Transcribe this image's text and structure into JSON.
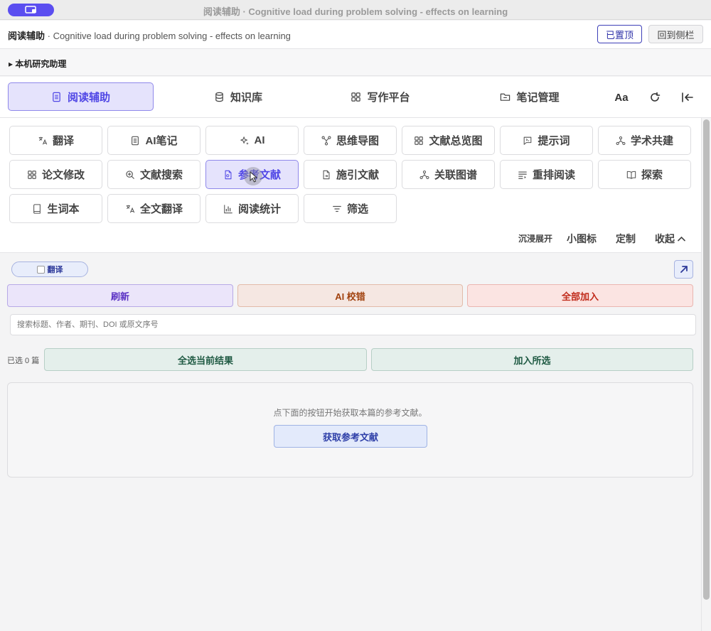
{
  "window": {
    "title": "阅读辅助 · Cognitive load during problem solving - effects on learning"
  },
  "header": {
    "app_name": "阅读辅助",
    "doc_title": " · Cognitive load during problem solving - effects on learning",
    "pinned_label": "已置顶",
    "back_label": "回到侧栏"
  },
  "assistant": {
    "label": "▸ 本机研究助理"
  },
  "main_nav": {
    "tabs": [
      {
        "label": "阅读辅助",
        "icon": "document-icon",
        "active": true
      },
      {
        "label": "知识库",
        "icon": "database-icon"
      },
      {
        "label": "写作平台",
        "icon": "grid-icon"
      },
      {
        "label": "笔记管理",
        "icon": "folder-icon"
      }
    ],
    "font_label": "Aa"
  },
  "tools": [
    {
      "label": "翻译",
      "icon": "translate-icon"
    },
    {
      "label": "AI笔记",
      "icon": "note-icon"
    },
    {
      "label": "AI",
      "icon": "sparkle-icon"
    },
    {
      "label": "思维导图",
      "icon": "mindmap-icon"
    },
    {
      "label": "文献总览图",
      "icon": "grid-icon"
    },
    {
      "label": "提示词",
      "icon": "prompt-icon"
    },
    {
      "label": "学术共建",
      "icon": "network-icon"
    },
    {
      "label": "论文修改",
      "icon": "grid-icon"
    },
    {
      "label": "文献搜索",
      "icon": "zoom-icon"
    },
    {
      "label": "参考文献",
      "icon": "reference-icon",
      "active": true
    },
    {
      "label": "施引文献",
      "icon": "citation-icon"
    },
    {
      "label": "关联图谱",
      "icon": "network-icon"
    },
    {
      "label": "重排阅读",
      "icon": "reflow-icon"
    },
    {
      "label": "探索",
      "icon": "book-icon"
    },
    {
      "label": "生词本",
      "icon": "wordbook-icon"
    },
    {
      "label": "全文翻译",
      "icon": "translate-icon"
    },
    {
      "label": "阅读统计",
      "icon": "chart-icon"
    },
    {
      "label": "筛选",
      "icon": "filter-icon"
    }
  ],
  "grid_options": {
    "immersive": "沉浸展开",
    "small_icons": "小图标",
    "customize": "定制",
    "collapse": "收起"
  },
  "panel": {
    "translate_toggle": "翻译",
    "translate_checked": false,
    "refresh_label": "刷新",
    "ai_check_label": "AI 校错",
    "add_all_label": "全部加入",
    "search_placeholder": "搜索标题、作者、期刊、DOI 或原文序号",
    "selected_count": "已选 0 篇",
    "select_all_label": "全选当前结果",
    "add_selected_label": "加入所选",
    "empty_message": "点下面的按钮开始获取本篇的参考文献。",
    "fetch_label": "获取参考文献"
  },
  "colors": {
    "accent": "#4f46e5",
    "accent_bg": "#e5e3fc"
  }
}
